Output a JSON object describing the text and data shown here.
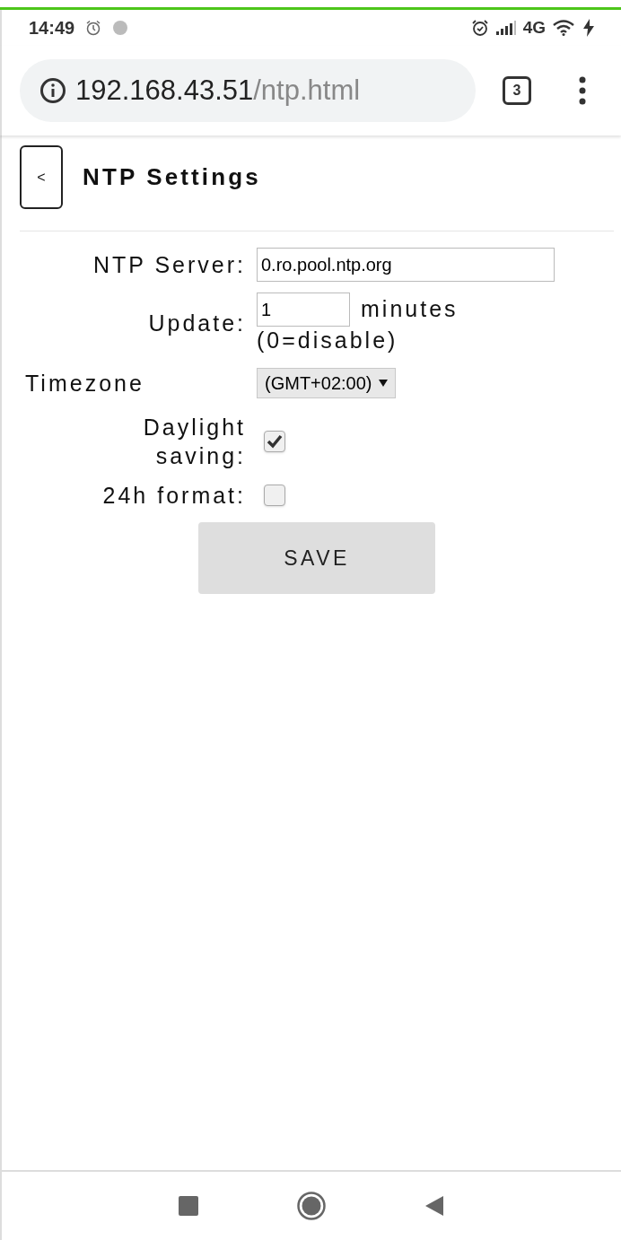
{
  "status_bar": {
    "time": "14:49",
    "network": "4G"
  },
  "browser": {
    "url_host": "192.168.43.51",
    "url_path": "/ntp.html",
    "tab_count": "3"
  },
  "header": {
    "back": "<",
    "title": "NTP Settings"
  },
  "form": [
    {
      "kind": "text",
      "label": "NTP Server:",
      "value": "0.ro.pool.ntp.org"
    },
    {
      "kind": "number",
      "label": "Update:",
      "value": "1",
      "suffix": "minutes",
      "note": "(0=disable)"
    },
    {
      "kind": "select",
      "label": "Timezone",
      "value": "(GMT+02:00)"
    },
    {
      "kind": "checkbox",
      "label": "Daylight saving:",
      "checked": true
    },
    {
      "kind": "checkbox",
      "label": "24h format:",
      "checked": false
    }
  ],
  "save_button": "SAVE"
}
